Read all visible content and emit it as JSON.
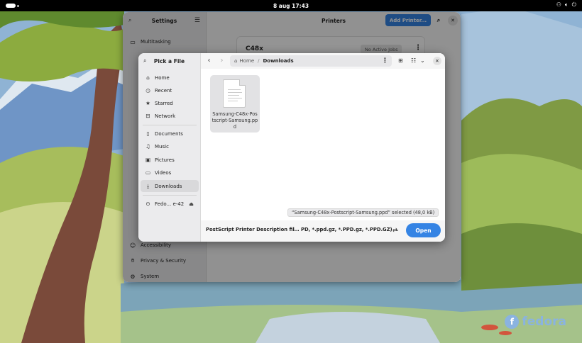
{
  "topbar": {
    "clock": "8 aug  17:43",
    "tray_icons": [
      "network-icon",
      "volume-icon",
      "power-icon"
    ]
  },
  "settings": {
    "title": "Settings",
    "panel_title": "Printers",
    "add_printer": "Add Printer...",
    "sidebar_items": [
      {
        "label": "Multitasking",
        "icon": "multitasking-icon",
        "glyph": "▭"
      },
      {
        "label": "Accessibility",
        "icon": "accessibility-icon",
        "glyph": "☺"
      },
      {
        "label": "Privacy & Security",
        "icon": "hand-icon",
        "glyph": "✋"
      },
      {
        "label": "System",
        "icon": "gear-icon",
        "glyph": "⚙"
      }
    ],
    "printer": {
      "name": "C48x",
      "status": "No Active Jobs"
    }
  },
  "dialog": {
    "title": "Pick a File",
    "places": [
      {
        "label": "Home",
        "icon": "home-icon",
        "glyph": "⌂"
      },
      {
        "label": "Recent",
        "icon": "clock-icon",
        "glyph": "◷"
      },
      {
        "label": "Starred",
        "icon": "star-icon",
        "glyph": "★"
      },
      {
        "label": "Network",
        "icon": "network-icon",
        "glyph": "⊟"
      }
    ],
    "folders": [
      {
        "label": "Documents",
        "icon": "document-icon",
        "glyph": "▯"
      },
      {
        "label": "Music",
        "icon": "music-icon",
        "glyph": "♫"
      },
      {
        "label": "Pictures",
        "icon": "pictures-icon",
        "glyph": "▣"
      },
      {
        "label": "Videos",
        "icon": "video-icon",
        "glyph": "▭"
      },
      {
        "label": "Downloads",
        "icon": "download-icon",
        "glyph": "⤓",
        "selected": true
      }
    ],
    "drive": {
      "label": "Fedo... e-42",
      "icon": "drive-icon",
      "eject_icon": "eject-icon"
    },
    "path": {
      "home": "Home",
      "current": "Downloads"
    },
    "file": {
      "name": "Samsung-C48x-Postscript-Samsung.ppd"
    },
    "selection_info": "“Samsung-C48x-Postscript-Samsung.ppd” selected  (48,0 kB)",
    "filter": "PostScript Printer Description fil… PD, *.ppd.gz, *.PPD.gz, *.PPD.GZ)",
    "open_label": "Open"
  },
  "wallpaper": {
    "brand": "fedora"
  },
  "colors": {
    "accent": "#3584e4",
    "topbar": "#000000"
  }
}
